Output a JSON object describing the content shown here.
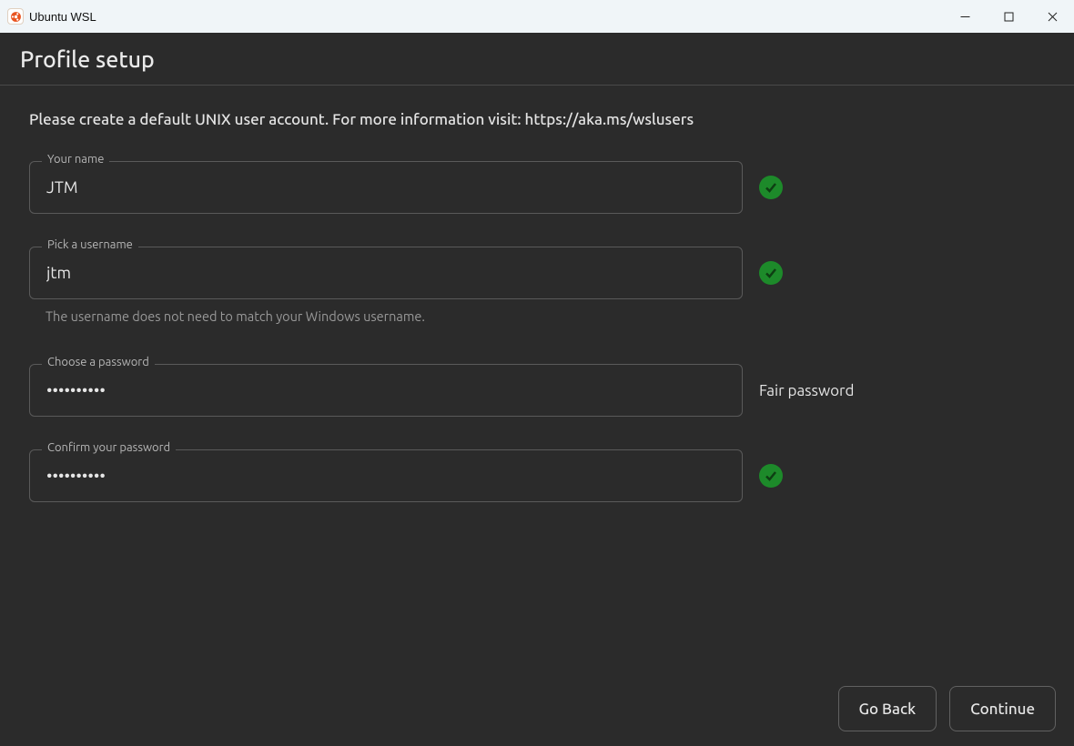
{
  "window": {
    "title": "Ubuntu WSL"
  },
  "page": {
    "title": "Profile setup",
    "intro": "Please create a default UNIX user account. For more information visit: https://aka.ms/wslusers"
  },
  "fields": {
    "name": {
      "label": "Your name",
      "value": "JTM",
      "valid": true
    },
    "username": {
      "label": "Pick a username",
      "value": "jtm",
      "valid": true,
      "helper": "The username does not need to match your Windows username."
    },
    "password": {
      "label": "Choose a password",
      "value": "••••••••••",
      "status_text": "Fair password"
    },
    "confirm": {
      "label": "Confirm your password",
      "value": "••••••••••",
      "valid": true
    }
  },
  "buttons": {
    "back": "Go Back",
    "continue": "Continue"
  },
  "colors": {
    "background": "#2b2b2b",
    "titlebar": "#f0f5f8",
    "accent_success": "#1d8a2a",
    "border": "#5a5a5a",
    "text": "#e6e6e6"
  }
}
